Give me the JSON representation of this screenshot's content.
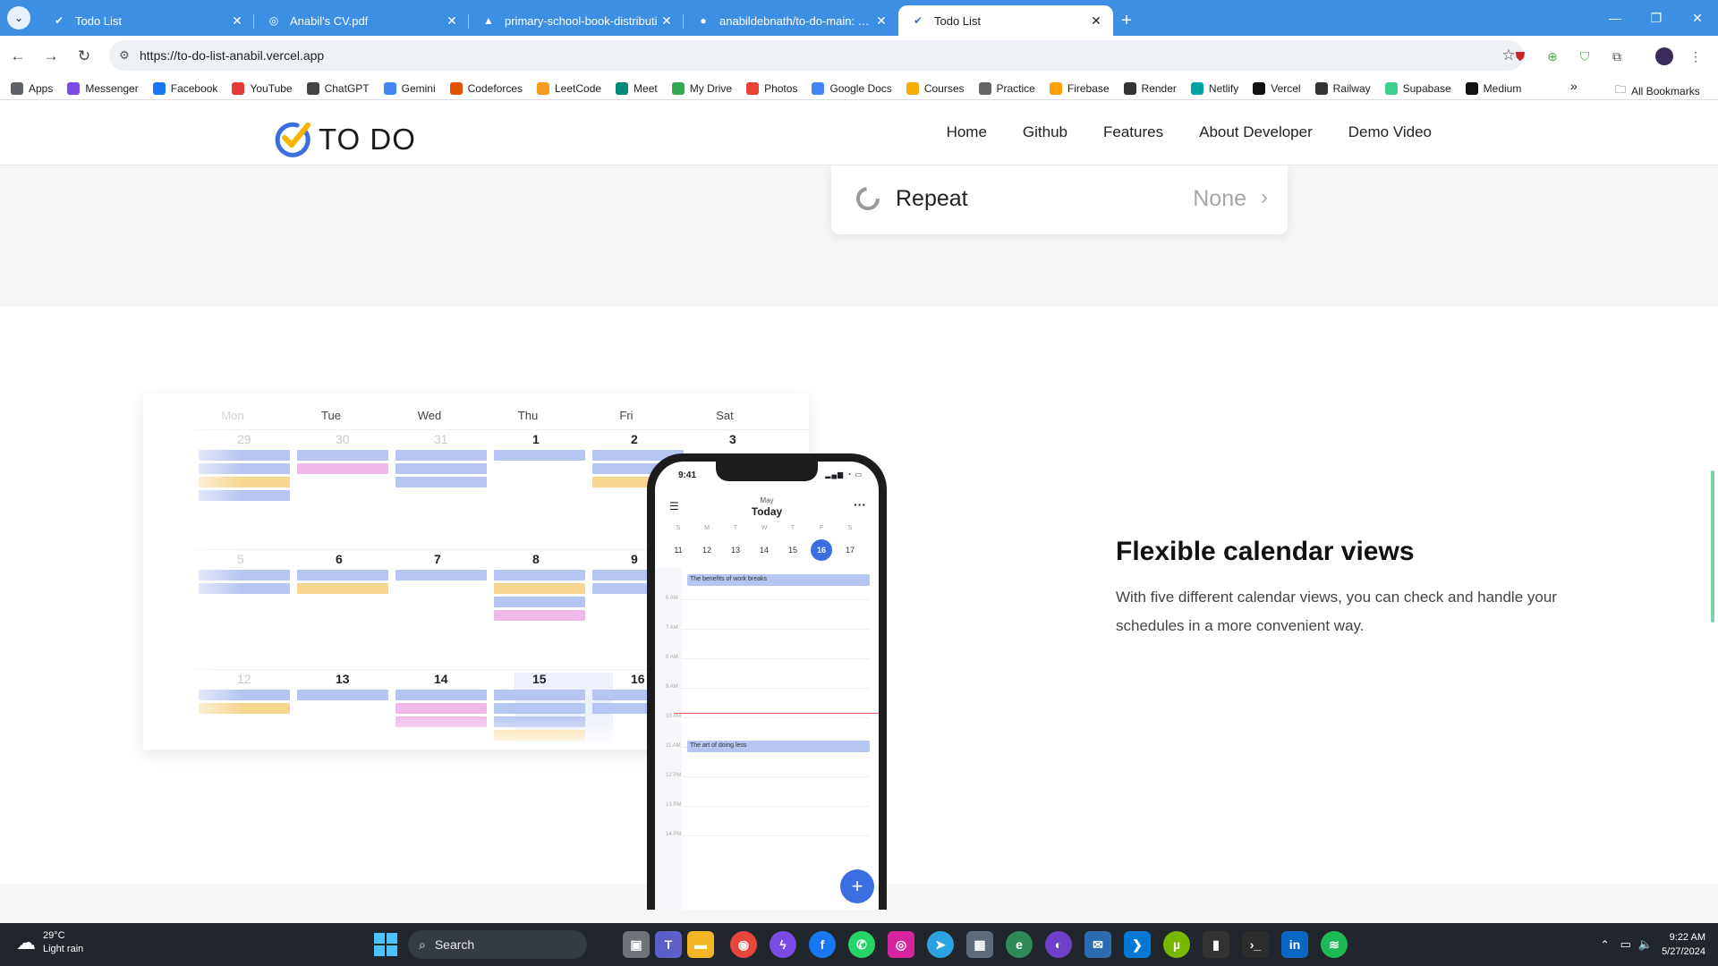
{
  "browser": {
    "tabs": [
      {
        "title": "Todo List",
        "active": false
      },
      {
        "title": "Anabil's CV.pdf",
        "active": false
      },
      {
        "title": "primary-school-book-distributi",
        "active": false
      },
      {
        "title": "anabildebnath/to-do-main: Thi",
        "active": false
      },
      {
        "title": "Todo List",
        "active": true
      }
    ],
    "new_tab": "+",
    "url": "https://to-do-list-anabil.vercel.app",
    "bookmarks": [
      "Apps",
      "Messenger",
      "Facebook",
      "YouTube",
      "ChatGPT",
      "Gemini",
      "Codeforces",
      "LeetCode",
      "Meet",
      "My Drive",
      "Photos",
      "Google Docs",
      "Courses",
      "Practice",
      "Firebase",
      "Render",
      "Netlify",
      "Vercel",
      "Railway",
      "Supabase",
      "Medium"
    ],
    "all_bookmarks": "All Bookmarks",
    "more": "»"
  },
  "site": {
    "logo_text": "TO DO",
    "nav": [
      "Home",
      "Github",
      "Features",
      "About Developer",
      "Demo Video"
    ],
    "repeat": {
      "label": "Repeat",
      "value": "None"
    },
    "feature": {
      "title": "Flexible calendar views",
      "description": "With five different calendar views, you can check and handle your schedules in a more convenient way."
    },
    "calendar": {
      "days": [
        "Mon",
        "Tue",
        "Wed",
        "Thu",
        "Fri",
        "Sat"
      ],
      "weeks": [
        [
          "29",
          "30",
          "31",
          "1",
          "2",
          "3"
        ],
        [
          "5",
          "6",
          "7",
          "8",
          "9",
          ""
        ],
        [
          "12",
          "13",
          "14",
          "15",
          "16",
          ""
        ]
      ]
    },
    "phone": {
      "time": "9:41",
      "month": "May",
      "title": "Today",
      "weekdays": [
        "S",
        "M",
        "T",
        "W",
        "T",
        "F",
        "S"
      ],
      "dates": [
        "11",
        "12",
        "13",
        "14",
        "15",
        "16",
        "17"
      ],
      "selected_date": "16",
      "hours": [
        "6 AM",
        "7 AM",
        "8 AM",
        "9 AM",
        "10 AM",
        "11 AM",
        "12 PM",
        "13 PM",
        "14 PM"
      ],
      "events": [
        "The benefits of work breaks",
        "The art of doing less"
      ],
      "fab": "+"
    }
  },
  "taskbar": {
    "temp": "29°C",
    "weather": "Light rain",
    "search": "Search",
    "time": "9:22 AM",
    "date": "5/27/2024"
  },
  "colors": {
    "tabbar": "#3c8fe2",
    "accent_blue": "#3b6ee0",
    "event_blue": "#b7c5f2",
    "event_pink": "#f1b8ea",
    "event_yellow": "#f7d690"
  }
}
